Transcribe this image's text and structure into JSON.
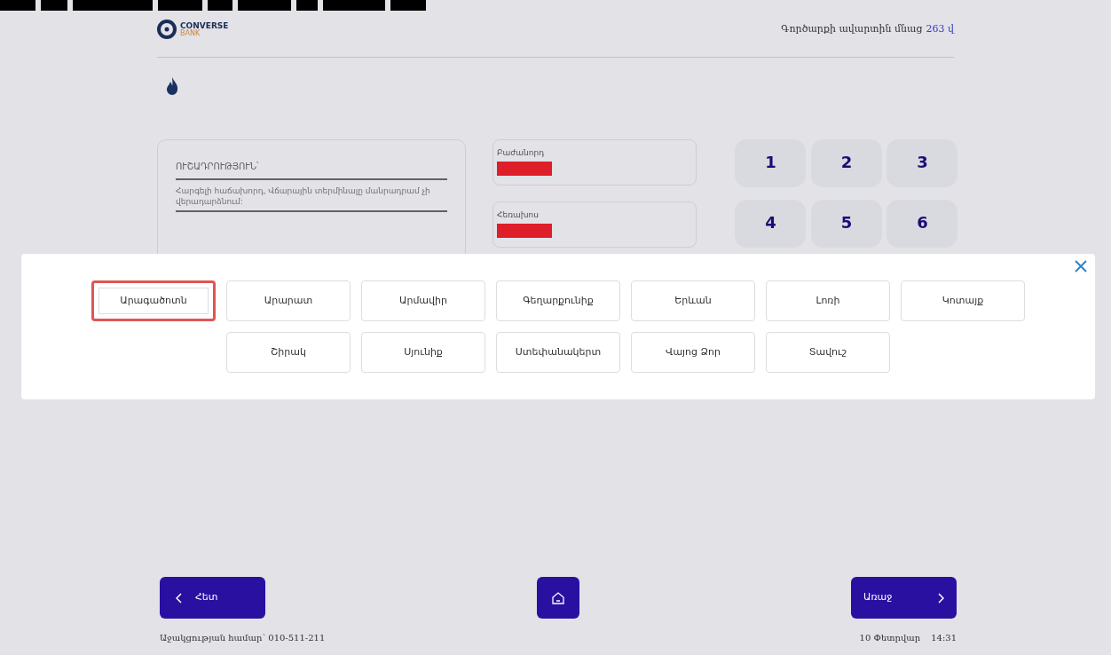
{
  "header": {
    "logo_top": "CONVERSE",
    "logo_bottom": "BANK",
    "timer_label": "Գործարքի ավարտին մնաց",
    "timer_value": "263 վ"
  },
  "notice": {
    "title": "ՈՒՇԱԴՐՈՒԹՅՈՒՆ՝",
    "text": "Հարգելի հաճախորդ, Վճարային տերմինալը մանրադրամ չի վերադարձնում:"
  },
  "fields": [
    {
      "label": "Բաժանորդ",
      "redacted": true
    },
    {
      "label": "Հեռախոս",
      "redacted": true
    }
  ],
  "keypad": [
    "1",
    "2",
    "3",
    "4",
    "5",
    "6"
  ],
  "modal": {
    "regions": [
      {
        "label": "Արագածոտն",
        "selected": true
      },
      {
        "label": "Արարատ",
        "selected": false
      },
      {
        "label": "Արմավիր",
        "selected": false
      },
      {
        "label": "Գեղարքունիք",
        "selected": false
      },
      {
        "label": "Երևան",
        "selected": false
      },
      {
        "label": "Լոռի",
        "selected": false
      },
      {
        "label": "Կոտայք",
        "selected": false
      },
      {
        "label": "Շիրակ",
        "selected": false
      },
      {
        "label": "Սյունիք",
        "selected": false
      },
      {
        "label": "Ստեփանակերտ",
        "selected": false
      },
      {
        "label": "Վայոց Ձոր",
        "selected": false
      },
      {
        "label": "Տավուշ",
        "selected": false
      }
    ]
  },
  "nav": {
    "back": "Հետ",
    "next": "Առաջ"
  },
  "footer": {
    "support": "Աջակցության համար՝ 010-511-211",
    "date": "10 Փետրվար",
    "time": "14:31"
  }
}
